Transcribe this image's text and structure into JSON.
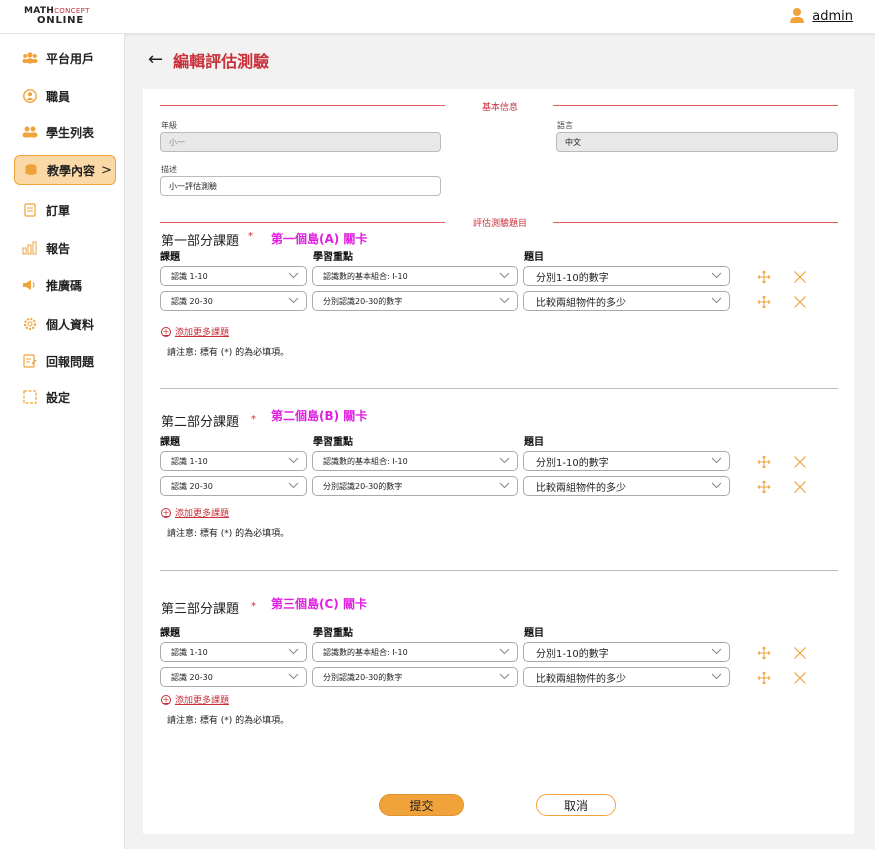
{
  "header": {
    "logo_line1_main": "MATH",
    "logo_line1_accent": "CONCEPT",
    "logo_line2": "ONLINE",
    "user_name": "admin"
  },
  "sidebar": {
    "items": [
      {
        "label": "平台用戶",
        "icon": "users-group-icon"
      },
      {
        "label": "職員",
        "icon": "staff-icon"
      },
      {
        "label": "學生列表",
        "icon": "students-icon"
      },
      {
        "label": "教學內容",
        "icon": "teaching-content-icon",
        "active": true,
        "chevron": ">"
      },
      {
        "label": "訂單",
        "icon": "order-icon"
      },
      {
        "label": "報告",
        "icon": "report-chart-icon"
      },
      {
        "label": "推廣碼",
        "icon": "megaphone-icon"
      },
      {
        "label": "個人資料",
        "icon": "gear-profile-icon"
      },
      {
        "label": "回報問題",
        "icon": "report-issue-icon"
      },
      {
        "label": "設定",
        "icon": "settings-frame-icon"
      }
    ]
  },
  "page": {
    "back_symbol": "←",
    "title": "編輯評估測驗"
  },
  "basic_info": {
    "section_label": "基本信息",
    "grade_label": "年級",
    "grade_value": "小一",
    "language_label": "語言",
    "language_value": "中文",
    "description_label": "描述",
    "description_value": "小一評估測驗"
  },
  "questions_section": {
    "section_label": "評估測驗題目",
    "col_topic": "課題",
    "col_focus": "學習重點",
    "col_question": "題目",
    "add_more": "添加更多課題",
    "note": "請注意:  標有 (*) 的為必填項。",
    "required_mark": "*",
    "parts": [
      {
        "title": "第一部分課題",
        "note": "第一個島(A) 關卡",
        "rows": [
          {
            "topic": "認識 1-10",
            "focus": "認識數的基本組合: I-10",
            "question": "分別1-10的數字"
          },
          {
            "topic": "認識 20-30",
            "focus": "分別認識20-30的數字",
            "question": "比較兩組物件的多少"
          }
        ]
      },
      {
        "title": "第二部分課題",
        "note": "第二個島(B) 關卡",
        "rows": [
          {
            "topic": "認識 1-10",
            "focus": "認識數的基本組合: I-10",
            "question": "分別1-10的數字"
          },
          {
            "topic": "認識 20-30",
            "focus": "分別認識20-30的數字",
            "question": "比較兩組物件的多少"
          }
        ]
      },
      {
        "title": "第三部分課題",
        "note": "第三個島(C) 關卡",
        "rows": [
          {
            "topic": "認識 1-10",
            "focus": "認識數的基本組合: I-10",
            "question": "分別1-10的數字"
          },
          {
            "topic": "認識 20-30",
            "focus": "分別認識20-30的數字",
            "question": "比較兩組物件的多少"
          }
        ]
      }
    ]
  },
  "actions": {
    "submit": "提交",
    "cancel": "取消"
  },
  "colors": {
    "accent_orange": "#f0a23b",
    "brand_red": "#c9303a",
    "note_magenta": "#e020e0"
  }
}
